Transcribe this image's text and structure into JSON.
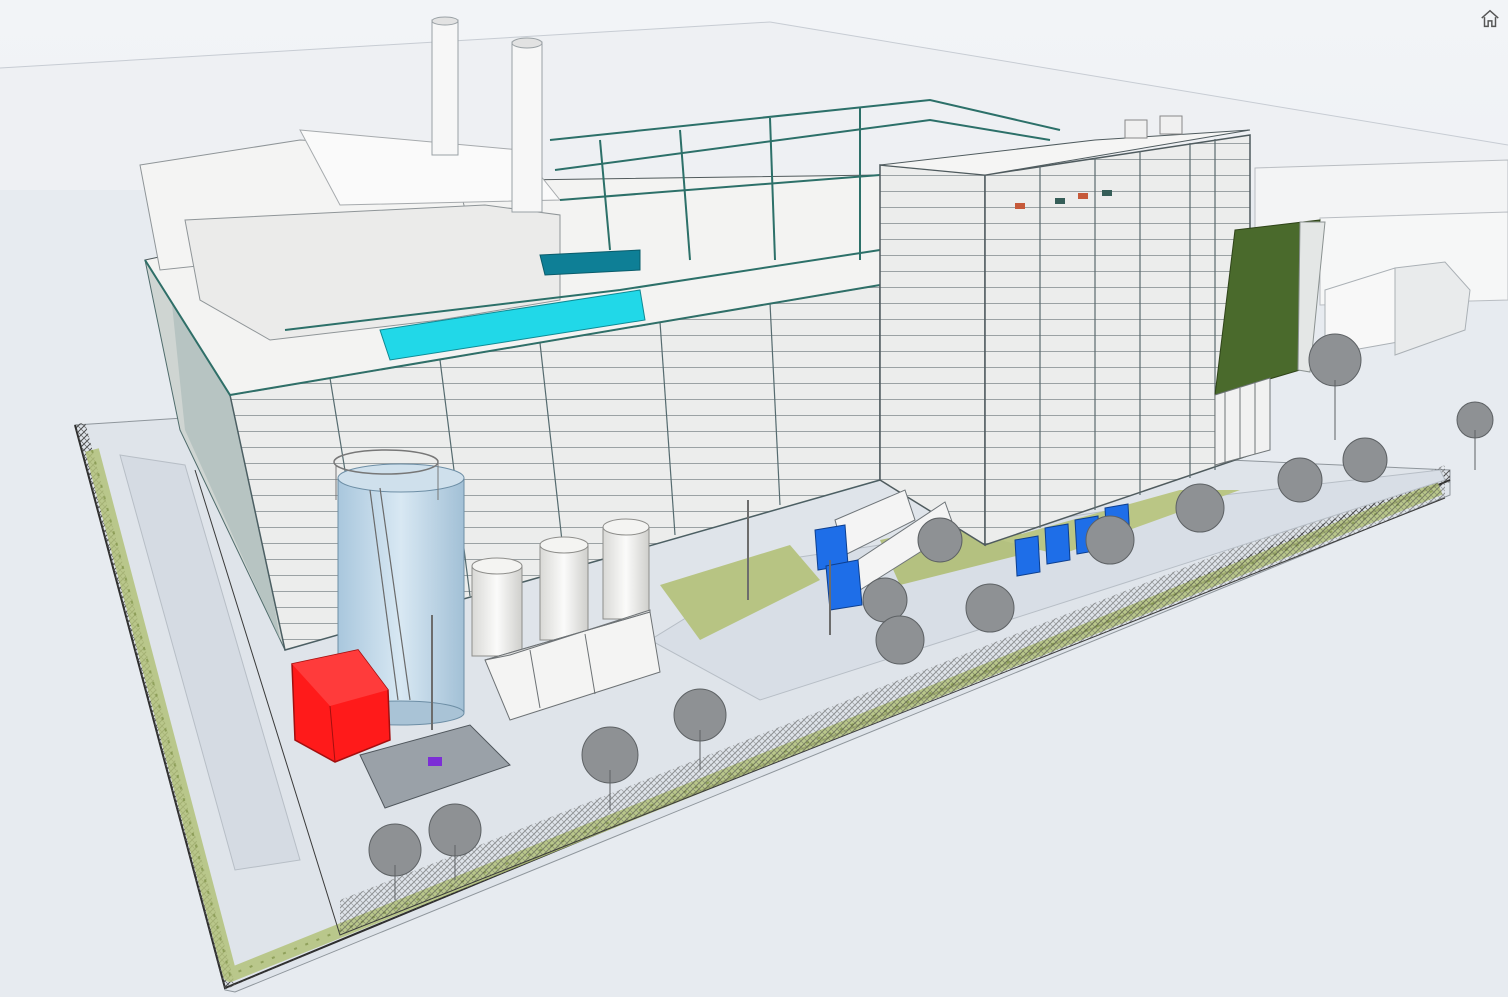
{
  "viewer": {
    "home_tooltip": "Home view",
    "home_icon": "home-icon",
    "accent_colors": {
      "generator_block": "#ff1a1a",
      "transformers": "#1e6ee8",
      "ductwork": "#19d4e6",
      "green_facade": "#4a6a2c",
      "hedge": "#a8b96c",
      "facade": "#eef0f0"
    }
  }
}
